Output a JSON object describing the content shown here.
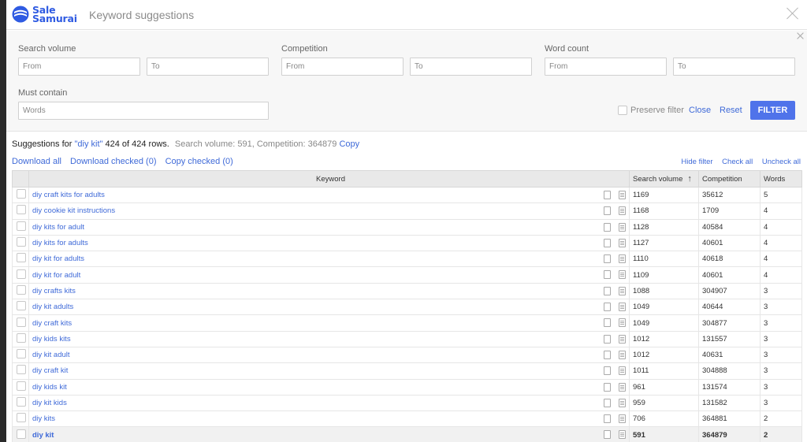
{
  "app": {
    "logo_line1": "Sale",
    "logo_line2": "Samurai",
    "title": "Keyword suggestions",
    "brand_color": "#2f5be2"
  },
  "filter": {
    "search_volume_label": "Search volume",
    "competition_label": "Competition",
    "word_count_label": "Word count",
    "must_contain_label": "Must contain",
    "from_placeholder": "From",
    "to_placeholder": "To",
    "words_placeholder": "Words",
    "preserve_label": "Preserve filter",
    "close_label": "Close",
    "reset_label": "Reset",
    "filter_label": "FILTER"
  },
  "summary": {
    "prefix": "Suggestions for",
    "query": "\"diy kit\"",
    "rows": "424 of 424 rows.",
    "meta": "Search volume: 591, Competition: 364879",
    "copy_label": "Copy"
  },
  "actions": {
    "download_all": "Download all",
    "download_checked": "Download checked (0)",
    "copy_checked": "Copy checked (0)",
    "hide_filter": "Hide filter",
    "check_all": "Check all",
    "uncheck_all": "Uncheck all"
  },
  "table": {
    "headers": {
      "keyword": "Keyword",
      "search_volume": "Search volume",
      "sort_indicator": "↑",
      "competition": "Competition",
      "words": "Words"
    },
    "rows": [
      {
        "keyword": "diy craft kits for adults",
        "volume": "1169",
        "competition": "35612",
        "words": "5"
      },
      {
        "keyword": "diy cookie kit instructions",
        "volume": "1168",
        "competition": "1709",
        "words": "4"
      },
      {
        "keyword": "diy kits for adult",
        "volume": "1128",
        "competition": "40584",
        "words": "4"
      },
      {
        "keyword": "diy kits for adults",
        "volume": "1127",
        "competition": "40601",
        "words": "4"
      },
      {
        "keyword": "diy kit for adults",
        "volume": "1110",
        "competition": "40618",
        "words": "4"
      },
      {
        "keyword": "diy kit for adult",
        "volume": "1109",
        "competition": "40601",
        "words": "4"
      },
      {
        "keyword": "diy crafts kits",
        "volume": "1088",
        "competition": "304907",
        "words": "3"
      },
      {
        "keyword": "diy kit adults",
        "volume": "1049",
        "competition": "40644",
        "words": "3"
      },
      {
        "keyword": "diy craft kits",
        "volume": "1049",
        "competition": "304877",
        "words": "3"
      },
      {
        "keyword": "diy kids kits",
        "volume": "1012",
        "competition": "131557",
        "words": "3"
      },
      {
        "keyword": "diy kit adult",
        "volume": "1012",
        "competition": "40631",
        "words": "3"
      },
      {
        "keyword": "diy craft kit",
        "volume": "1011",
        "competition": "304888",
        "words": "3"
      },
      {
        "keyword": "diy kids kit",
        "volume": "961",
        "competition": "131574",
        "words": "3"
      },
      {
        "keyword": "diy kit kids",
        "volume": "959",
        "competition": "131582",
        "words": "3"
      },
      {
        "keyword": "diy kits",
        "volume": "706",
        "competition": "364881",
        "words": "2"
      },
      {
        "keyword": "diy kit",
        "volume": "591",
        "competition": "364879",
        "words": "2",
        "highlight": true
      }
    ]
  }
}
